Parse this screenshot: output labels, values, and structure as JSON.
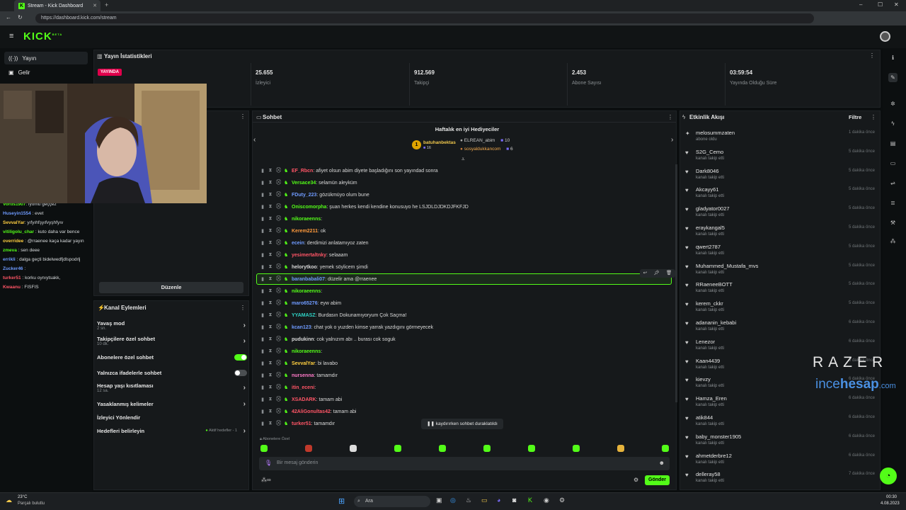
{
  "browser": {
    "tab_title": "Stream - Kick Dashboard",
    "url": "https://dashboard.kick.com/stream"
  },
  "app": {
    "logo": "KICK",
    "logo_sup": "BETA"
  },
  "sidebar": {
    "items": [
      {
        "label": "Yayın",
        "icon": "broadcast-icon"
      },
      {
        "label": "Gelir",
        "icon": "revenue-icon"
      }
    ]
  },
  "stats": {
    "title": "Yayın İstatistikleri",
    "live_badge": "YAYINDA",
    "items": [
      {
        "value": "25.655",
        "label": "İzleyici"
      },
      {
        "value": "912.569",
        "label": "Takipçi"
      },
      {
        "value": "2.453",
        "label": "Abone Sayısı"
      },
      {
        "value": "03:59:54",
        "label": "Yayında Olduğu Süre"
      }
    ]
  },
  "preview": {
    "edit_label": "Düzenle"
  },
  "left_chat": [
    {
      "user": "Vortis1907",
      "text": "iyomu geççez",
      "color": "#53fc18"
    },
    {
      "user": "Huseyin1554",
      "text": "evet",
      "color": "#6f9bff"
    },
    {
      "user": "SevvalYar",
      "text": "yıfyıhfşyıfvyşhfyıv",
      "color": "#ffcf40"
    },
    {
      "user": "vitiligolu_char",
      "text": "kuto daha var bence",
      "color": "#53fc18"
    },
    {
      "user": "overridee",
      "text": "@rraenee kaça kadar yayın",
      "color": "#ffcf40"
    },
    {
      "user": "zmeva",
      "text": "sen deee",
      "color": "#53fc18"
    },
    {
      "user": "errikli",
      "text": "dalga geçti bidelwedfjdlspodrlj",
      "color": "#6f9bff"
    },
    {
      "user": "Zucker46",
      "text": "",
      "color": "#6f9bff"
    },
    {
      "user": "turker51",
      "text": "korku oynıytsakk,",
      "color": "#ff5566"
    },
    {
      "user": "Kwaanu",
      "text": "FISFIS",
      "color": "#ff5566"
    }
  ],
  "actions": {
    "title": "Kanal Eylemleri",
    "items": [
      {
        "label": "Yavaş mod",
        "sub": "2 sn.",
        "kind": "chevron"
      },
      {
        "label": "Takipçilere özel sohbet",
        "sub": "10 dk.",
        "kind": "chevron"
      },
      {
        "label": "Abonelere özel sohbet",
        "sub": "",
        "kind": "toggle-on"
      },
      {
        "label": "Yalnızca ifadelerle sohbet",
        "sub": "",
        "kind": "toggle-off"
      },
      {
        "label": "Hesap yaşı kısıtlaması",
        "sub": "12 sa.",
        "kind": "chevron"
      },
      {
        "label": "Yasaklanmış kelimeler",
        "sub": "",
        "kind": "chevron"
      },
      {
        "label": "İzleyici Yönlendir",
        "sub": "",
        "kind": "none"
      },
      {
        "label": "Hedefleri belirleyin",
        "sub": "",
        "kind": "goal",
        "extra": "Aktif hedefler - 1"
      }
    ]
  },
  "chat": {
    "title": "Sohbet",
    "gifters_title": "Haftalık en iyi Hediyeciler",
    "top_gifter": {
      "name": "batuhanbektas",
      "count": "16",
      "rank": "1"
    },
    "gifters": [
      {
        "name": "ELREAN_abim",
        "count": "10"
      },
      {
        "name": "sosyaldukkancom",
        "count": "6"
      }
    ],
    "messages": [
      {
        "user": "EF_Rbcn",
        "text": "afiyet olsun abim diyete başladığını son yayındad sonra",
        "color": "#ff5566"
      },
      {
        "user": "Versace34",
        "text": "selamün aleyküm",
        "color": "#53fc18"
      },
      {
        "user": "FDuty_223",
        "text": "gözükmüyo olum bune",
        "color": "#6f9bff"
      },
      {
        "user": "Oniscomorpha",
        "text": "şuan herkes kendi kendine konusuyo he LSJDLDJDKDJFKFJD",
        "color": "#53fc18"
      },
      {
        "user": "nikoraeenns",
        "text": "",
        "color": "#53fc18"
      },
      {
        "user": "Kerem2211",
        "text": "ok",
        "color": "#ff9a3c"
      },
      {
        "user": "ecein",
        "text": "derdimizi anlatamıyoz zaten",
        "color": "#6f9bff"
      },
      {
        "user": "yesimertaltnky",
        "text": "selaaam",
        "color": "#ff5566"
      },
      {
        "user": "helorytkoo",
        "text": "yemek söylicem şimdi",
        "color": "#d9d9d9"
      },
      {
        "user": "baranbabali07",
        "text": "düzelir ama @rraenee",
        "color": "#6f9bff"
      },
      {
        "user": "nikoraeenns",
        "text": "",
        "color": "#53fc18"
      },
      {
        "user": "maro65276",
        "text": "eyw abim",
        "color": "#6f9bff"
      },
      {
        "user": "YYAMASZ",
        "text": "Burdasın Dokunamıyoryum Çok Saçma!",
        "color": "#2fd3c5"
      },
      {
        "user": "kcan123",
        "text": "chat yok o yuzden kimse yarrak yazdıgını görmeyecek",
        "color": "#6f9bff"
      },
      {
        "user": "pudukinn",
        "text": "cok yalnızım abı .. burası cok soguk",
        "color": "#d9d9d9"
      },
      {
        "user": "nikoraeenns",
        "text": "",
        "color": "#53fc18"
      },
      {
        "user": "SevvalYar",
        "text": "bi lavabo",
        "color": "#ffcf40"
      },
      {
        "user": "nursenna",
        "text": "tamamdır",
        "color": "#ff7ac8"
      },
      {
        "user": "itin_eceni",
        "text": "",
        "color": "#ff5566"
      },
      {
        "user": "XSADARK",
        "text": "tamam abi",
        "color": "#ff5566"
      },
      {
        "user": "42AliGonultas42",
        "text": "tamam abi",
        "color": "#ff5566"
      },
      {
        "user": "turker51",
        "text": "tamamdır",
        "color": "#ff5566"
      }
    ],
    "paused_label": "kaydırırken sohbet duraklatıldı",
    "emote_section": "Abonelere Özel",
    "input_placeholder": "Bir mesaj gönderin",
    "send_label": "Gönder"
  },
  "events": {
    "title": "Etkinlik Akışı",
    "filter_label": "Filtre",
    "items": [
      {
        "user": "melosummzaten",
        "action": "abone oldu",
        "time": "1 dakika önce",
        "icon": "star-icon"
      },
      {
        "user": "S2G_Cemo",
        "action": "kanalı takip etti",
        "time": "5 dakika önce",
        "icon": "heart-icon"
      },
      {
        "user": "Dark8046",
        "action": "kanalı takip etti",
        "time": "5 dakika önce",
        "icon": "heart-icon"
      },
      {
        "user": "Akcayy61",
        "action": "kanalı takip etti",
        "time": "5 dakika önce",
        "icon": "heart-icon"
      },
      {
        "user": "gladyator0027",
        "action": "kanalı takip etti",
        "time": "5 dakika önce",
        "icon": "heart-icon"
      },
      {
        "user": "eraykangal5",
        "action": "kanalı takip etti",
        "time": "5 dakika önce",
        "icon": "heart-icon"
      },
      {
        "user": "qwert2787",
        "action": "kanalı takip etti",
        "time": "5 dakika önce",
        "icon": "heart-icon"
      },
      {
        "user": "Muhammed_Mustafa_mvs",
        "action": "kanalı takip etti",
        "time": "5 dakika önce",
        "icon": "heart-icon"
      },
      {
        "user": "RRaeneeBOTT",
        "action": "kanalı takip etti",
        "time": "5 dakika önce",
        "icon": "heart-icon"
      },
      {
        "user": "kerem_ckkr",
        "action": "kanalı takip etti",
        "time": "5 dakika önce",
        "icon": "heart-icon"
      },
      {
        "user": "adananin_kebabi",
        "action": "kanalı takip etti",
        "time": "6 dakika önce",
        "icon": "heart-icon"
      },
      {
        "user": "Lenezor",
        "action": "kanalı takip etti",
        "time": "6 dakika önce",
        "icon": "heart-icon"
      },
      {
        "user": "Kaan4439",
        "action": "kanalı takip etti",
        "time": "6 dakika önce",
        "icon": "heart-icon"
      },
      {
        "user": "kievzy",
        "action": "kanalı takip etti",
        "time": "6 dakika önce",
        "icon": "heart-icon"
      },
      {
        "user": "Hamza_Eren",
        "action": "kanalı takip etti",
        "time": "6 dakika önce",
        "icon": "heart-icon"
      },
      {
        "user": "atik844",
        "action": "kanalı takip etti",
        "time": "6 dakika önce",
        "icon": "heart-icon"
      },
      {
        "user": "baby_monster1905",
        "action": "kanalı takip etti",
        "time": "6 dakika önce",
        "icon": "heart-icon"
      },
      {
        "user": "ahmetderbre12",
        "action": "kanalı takip etti",
        "time": "6 dakika önce",
        "icon": "heart-icon"
      },
      {
        "user": "delleray58",
        "action": "kanalı takip etti",
        "time": "7 dakika önce",
        "icon": "heart-icon"
      }
    ]
  },
  "overlay": {
    "razer": "RAZER",
    "incehesap_a": "ince",
    "incehesap_b": "hesap",
    ".com": ".com"
  },
  "taskbar": {
    "weather_temp": "23°C",
    "weather_desc": "Parçalı bulutlu",
    "search": "Ara",
    "time": "00:30",
    "date": "4.08.2023"
  },
  "colors": {
    "accent": "#53fc18",
    "live": "#e0004b",
    "panel": "#16191b"
  }
}
